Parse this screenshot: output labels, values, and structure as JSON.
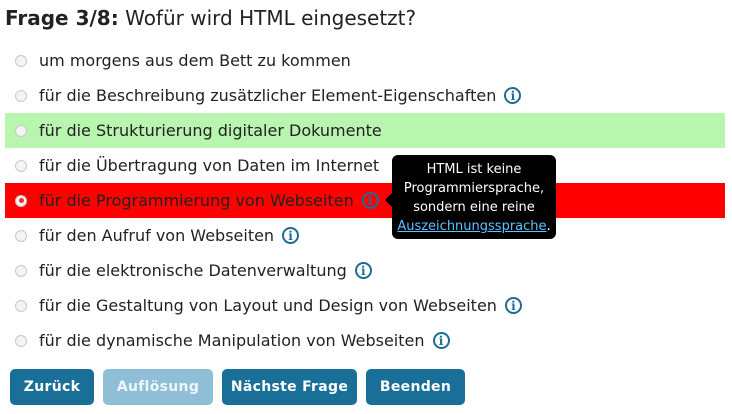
{
  "question": {
    "number": "Frage 3/8:",
    "text": "Wofür wird HTML eingesetzt?"
  },
  "options": [
    {
      "label": "um morgens aus dem Bett zu kommen",
      "state": "none",
      "has_info": false
    },
    {
      "label": "für die Beschreibung zusätzlicher Element-Eigenschaften",
      "state": "none",
      "has_info": true
    },
    {
      "label": "für die Strukturierung digitaler Dokumente",
      "state": "correct",
      "has_info": false
    },
    {
      "label": "für die Übertragung von Daten im Internet",
      "state": "none",
      "has_info": false
    },
    {
      "label": "für die Programmierung von Webseiten",
      "state": "wrong-selected",
      "has_info": true
    },
    {
      "label": "für den Aufruf von Webseiten",
      "state": "none",
      "has_info": true
    },
    {
      "label": "für die elektronische Datenverwaltung",
      "state": "none",
      "has_info": true
    },
    {
      "label": "für die Gestaltung von Layout und Design von Webseiten",
      "state": "none",
      "has_info": true
    },
    {
      "label": "für die dynamische Manipulation von Webseiten",
      "state": "none",
      "has_info": true
    }
  ],
  "info_icon_glyph": "i",
  "tooltip": {
    "line1": "HTML ist keine",
    "line2": "Programmiersprache,",
    "line3": "sondern eine reine",
    "link": "Auszeichnungssprache",
    "suffix": "."
  },
  "buttons": {
    "back": "Zurück",
    "solution": "Auflösung",
    "next": "Nächste Frage",
    "finish": "Beenden"
  },
  "colors": {
    "correct_bg": "#b8f5ae",
    "wrong_bg": "#ff0000",
    "button_bg": "#1a6f98",
    "button_disabled_bg": "#8fbfd6",
    "info_icon": "#1c6c93"
  }
}
